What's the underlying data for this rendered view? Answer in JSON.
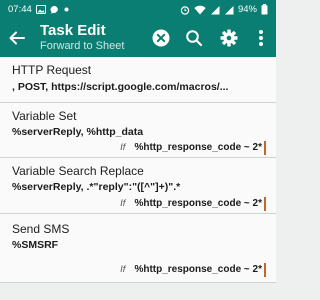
{
  "status_bar": {
    "time": "07:44",
    "battery": "94%"
  },
  "app_bar": {
    "title": "Task Edit",
    "subtitle": "Forward to Sheet"
  },
  "actions": [
    {
      "name": "HTTP Request",
      "args": ", POST, https://script.google.com/macros/...",
      "condition": null
    },
    {
      "name": "Variable Set",
      "args": "%serverReply, %http_data",
      "if_label": "If",
      "condition": "%http_response_code ~ 2*"
    },
    {
      "name": "Variable Search Replace",
      "args": "%serverReply, .*\"reply\":\"([^\"]+)\".*",
      "if_label": "If",
      "condition": "%http_response_code ~ 2*"
    },
    {
      "name": "Send SMS",
      "args": "%SMSRF",
      "if_label": "If",
      "condition": "%http_response_code ~ 2*"
    }
  ],
  "colors": {
    "primary": "#0a7e72",
    "background": "#eef0ef",
    "condition_marker": "#c3662a"
  }
}
